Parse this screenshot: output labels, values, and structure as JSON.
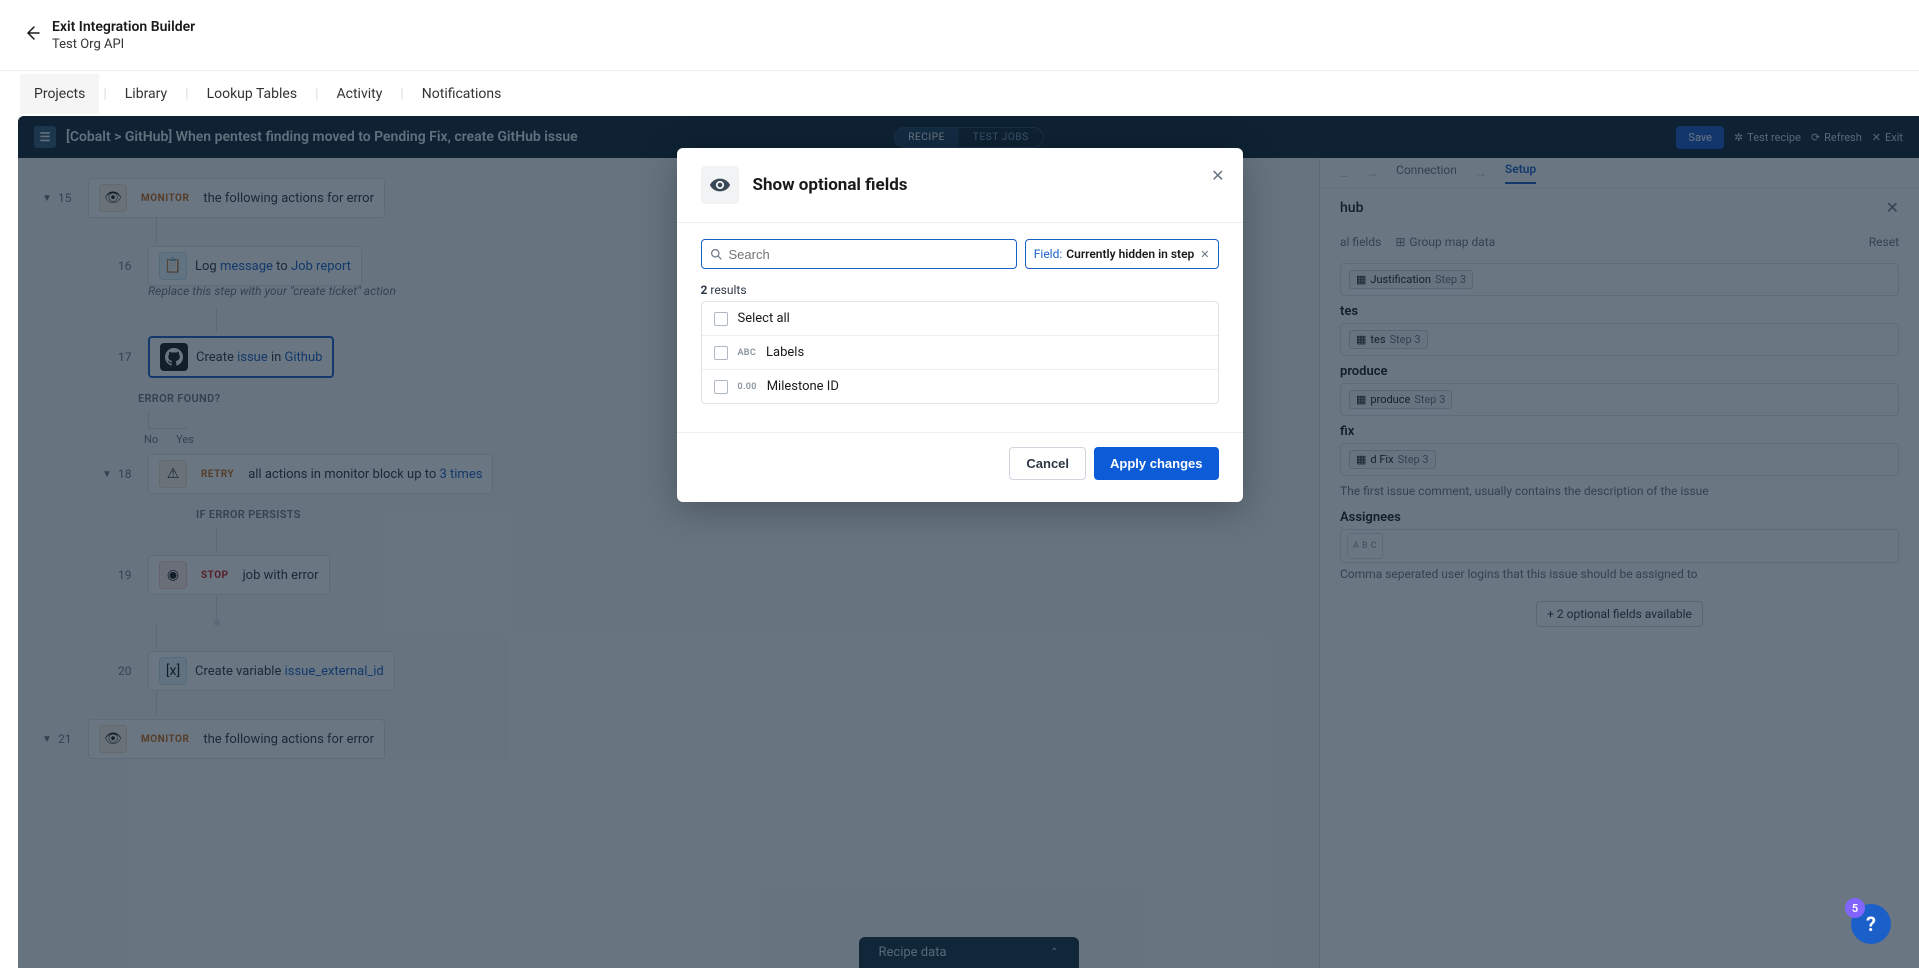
{
  "header": {
    "exit_label": "Exit Integration Builder",
    "subtitle": "Test Org API"
  },
  "nav": {
    "projects": "Projects",
    "library": "Library",
    "lookup": "Lookup Tables",
    "activity": "Activity",
    "notifications": "Notifications"
  },
  "canvas": {
    "title": "[Cobalt > GitHub] When pentest finding moved to Pending Fix, create GitHub issue",
    "toggle_recipe": "RECIPE",
    "toggle_jobs": "TEST JOBS",
    "save": "Save",
    "test": "Test recipe",
    "refresh": "Refresh",
    "exit": "Exit"
  },
  "steps": {
    "s15_num": "15",
    "s15_badge": "MONITOR",
    "s15_text": "the following actions for error",
    "s16_num": "16",
    "s16_text1": "Log ",
    "s16_link1": "message",
    "s16_text2": " to ",
    "s16_link2": "Job report",
    "s16_sub": "Replace this step with your \"create ticket\" action",
    "s17_num": "17",
    "s17_text1": "Create ",
    "s17_link1": "issue",
    "s17_text2": " in ",
    "s17_link2": "Github",
    "err_label": "ERROR FOUND?",
    "yes": "Yes",
    "no": "No",
    "s18_num": "18",
    "s18_badge": "RETRY",
    "s18_text1": "all actions in monitor block up to ",
    "s18_link": "3 times",
    "persist_label": "IF ERROR PERSISTS",
    "s19_num": "19",
    "s19_badge": "STOP",
    "s19_text": "job with error",
    "s20_num": "20",
    "s20_text1": "Create variable ",
    "s20_link": "issue_external_id",
    "s21_num": "21",
    "s21_badge": "MONITOR",
    "s21_text": "the following actions for error"
  },
  "right": {
    "tab_connection": "Connection",
    "tab_setup": "Setup",
    "title_suffix": "hub",
    "optional_fields": "al fields",
    "group_map": "Group map data",
    "reset": "Reset",
    "pill1_label": "Justification",
    "pill1_step": "Step 3",
    "label_prereq": "tes",
    "pill2_label": "tes",
    "pill2_step": "Step 3",
    "label_repro": "produce",
    "pill3_label": "produce",
    "pill3_step": "Step 3",
    "label_fix": "fix",
    "pill4_label": "d Fix",
    "pill4_step": "Step 3",
    "body_help": "The first issue comment, usually contains the description of the issue",
    "assignees_label": "Assignees",
    "assignees_help": "Comma seperated user logins that this issue should be assigned to",
    "optional_btn": "+ 2 optional fields available",
    "abc": "A B C"
  },
  "bottom_tab": "Recipe data",
  "modal": {
    "title": "Show optional fields",
    "search_placeholder": "Search",
    "filter_label": "Field:",
    "filter_value": "Currently hidden in step",
    "results_num": "2",
    "results_word": " results",
    "select_all": "Select all",
    "opt1_type": "ABC",
    "opt1_label": "Labels",
    "opt2_type": "0.00",
    "opt2_label": "Milestone ID",
    "cancel": "Cancel",
    "apply": "Apply changes"
  },
  "help_badge": "5"
}
